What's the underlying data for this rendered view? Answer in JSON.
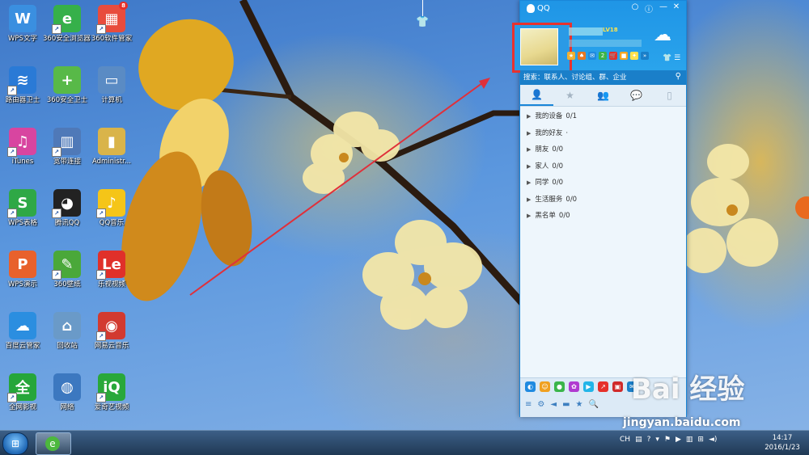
{
  "desktop_icons": [
    {
      "label": "WPS文字",
      "glyph": "W",
      "color": "#3a8fe0"
    },
    {
      "label": "360安全浏览器7",
      "glyph": "e",
      "color": "#36b04a"
    },
    {
      "label": "360软件管家",
      "glyph": "▦",
      "color": "#e84c3d",
      "badge": "8"
    },
    {
      "label": "路由器卫士",
      "glyph": "≋",
      "color": "#2a7ad6"
    },
    {
      "label": "360安全卫士",
      "glyph": "+",
      "color": "#58b948"
    },
    {
      "label": "计算机",
      "glyph": "▭",
      "color": "#5a8bc4"
    },
    {
      "label": "iTunes",
      "glyph": "♫",
      "color": "#d845a0"
    },
    {
      "label": "宽带连接",
      "glyph": "▥",
      "color": "#4f79b8"
    },
    {
      "label": "Administr...",
      "glyph": "▮",
      "color": "#d9b44a"
    },
    {
      "label": "WPS表格",
      "glyph": "S",
      "color": "#2fa846"
    },
    {
      "label": "腾讯QQ",
      "glyph": "◕",
      "color": "#222222"
    },
    {
      "label": "QQ音乐",
      "glyph": "♪",
      "color": "#f5c518"
    },
    {
      "label": "WPS演示",
      "glyph": "P",
      "color": "#e8612c"
    },
    {
      "label": "360壁纸",
      "glyph": "✎",
      "color": "#4aa83a"
    },
    {
      "label": "乐视视频",
      "glyph": "Le",
      "color": "#e0302a"
    },
    {
      "label": "百度云管家",
      "glyph": "☁",
      "color": "#2b8ee0"
    },
    {
      "label": "回收站",
      "glyph": "⌂",
      "color": "#6a9ac8"
    },
    {
      "label": "网易云音乐",
      "glyph": "◉",
      "color": "#d23a30"
    },
    {
      "label": "全网影视",
      "glyph": "全",
      "color": "#26a63a"
    },
    {
      "label": "网络",
      "glyph": "◍",
      "color": "#3c78c0"
    },
    {
      "label": "爱奇艺视频",
      "glyph": "iQ",
      "color": "#29a83a"
    }
  ],
  "qq": {
    "title": "QQ",
    "window_buttons": [
      "○",
      "ⓘ",
      "—",
      "✕"
    ],
    "level": "LV18",
    "services": [
      "★",
      "♠",
      "✉",
      "2",
      "🛒",
      "■",
      "✦",
      "»"
    ],
    "search_placeholder": "搜索：联系人、讨论组、群、企业",
    "tabs": [
      "👤",
      "★",
      "👥",
      "💬",
      "▯"
    ],
    "groups": [
      {
        "name": "我的设备",
        "count": "0/1"
      },
      {
        "name": "我的好友",
        "count": "·"
      },
      {
        "name": "朋友",
        "count": "0/0"
      },
      {
        "name": "家人",
        "count": "0/0"
      },
      {
        "name": "同学",
        "count": "0/0"
      },
      {
        "name": "生活服务",
        "count": "0/0"
      },
      {
        "name": "黑名单",
        "count": "0/0"
      }
    ],
    "apps_row1": [
      "◐",
      "☺",
      "●",
      "✿",
      "▶",
      "↗",
      "▣",
      "✉"
    ],
    "apps_row2": [
      "≡",
      "⚙",
      "◄",
      "▬",
      "★",
      "🔍"
    ]
  },
  "taskbar": {
    "start": "⊞",
    "pinned": "e",
    "tray": [
      "CH",
      "▤",
      "?",
      "▾",
      "⚑",
      "▶",
      "▥",
      "⊞",
      "◄)"
    ],
    "time": "14:17",
    "date": "2016/1/23"
  },
  "watermark": {
    "logo": "Bai 经验",
    "url": "jingyan.baidu.com"
  },
  "shirt_icon": "👕"
}
